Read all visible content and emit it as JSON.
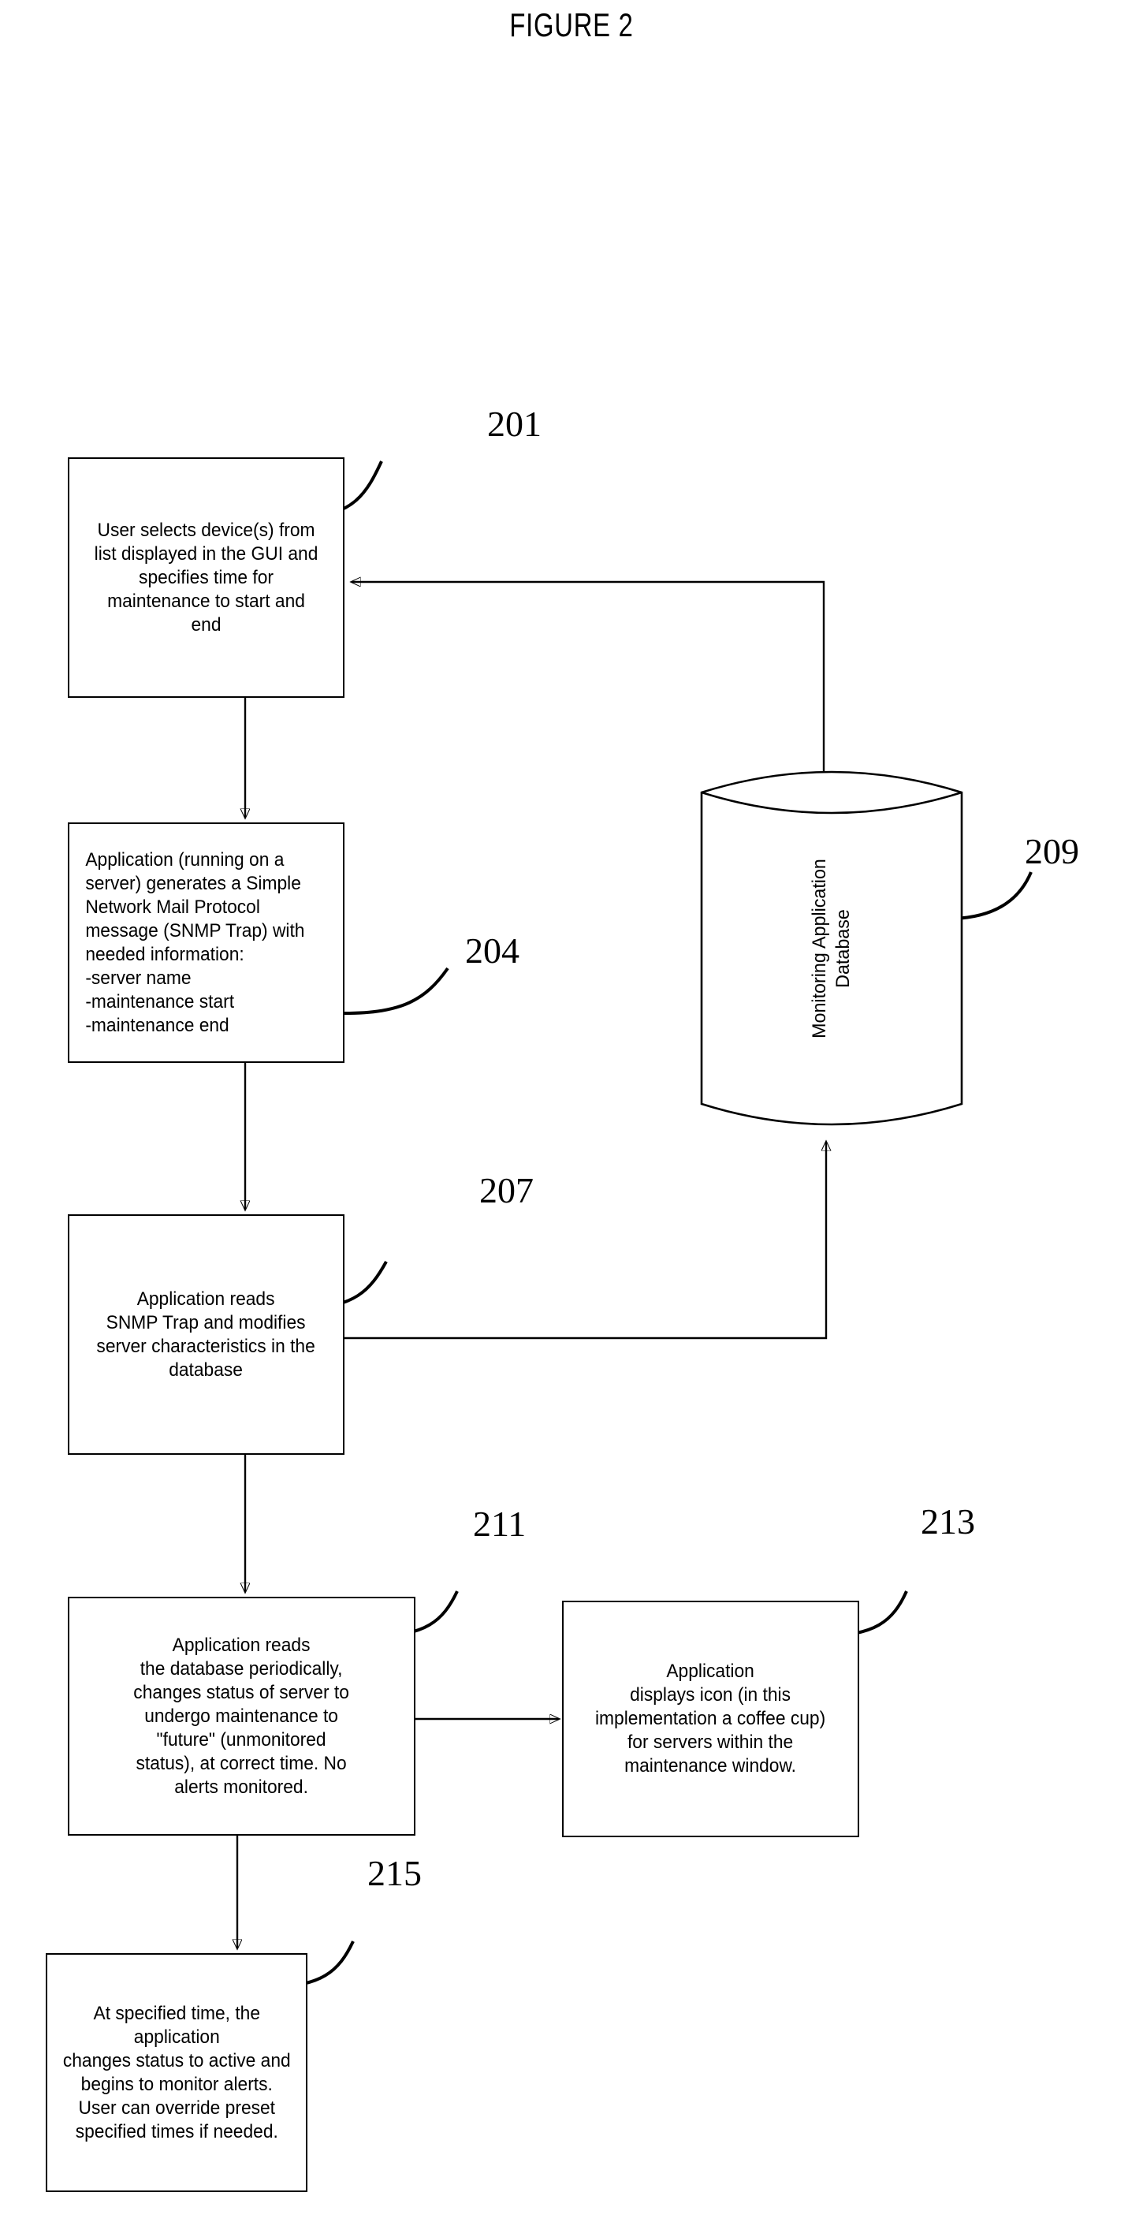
{
  "figure": {
    "title": "FIGURE 2",
    "type": "patent-flowchart"
  },
  "nodes": [
    {
      "id": "201",
      "ref": "201",
      "shape": "process-box",
      "align": "center",
      "text": "User selects device(s) from\nlist displayed in the GUI and\nspecifies time for\nmaintenance to start and\nend"
    },
    {
      "id": "204",
      "ref": "204",
      "shape": "process-box",
      "align": "left",
      "text": "Application (running on a\nserver) generates a Simple\nNetwork Mail Protocol\nmessage (SNMP Trap) with\nneeded information:\n-server name\n-maintenance start\n-maintenance end"
    },
    {
      "id": "207",
      "ref": "207",
      "shape": "process-box",
      "align": "center",
      "text": "Application reads\nSNMP Trap and modifies\nserver characteristics in the\ndatabase"
    },
    {
      "id": "209",
      "ref": "209",
      "shape": "cylinder-database",
      "align": "center",
      "text": "Monitoring Application\nDatabase"
    },
    {
      "id": "211",
      "ref": "211",
      "shape": "process-box",
      "align": "center",
      "text": "Application reads\nthe database periodically,\nchanges status of server to\nundergo maintenance to\n\"future\" (unmonitored\nstatus), at correct time. No\nalerts monitored."
    },
    {
      "id": "213",
      "ref": "213",
      "shape": "process-box",
      "align": "center",
      "text": "Application\ndisplays icon  (in this\nimplementation a coffee cup)\nfor servers within the\nmaintenance window."
    },
    {
      "id": "215",
      "ref": "215",
      "shape": "process-box",
      "align": "center",
      "text": "At specified time, the\napplication\nchanges status to active and\nbegins to monitor alerts.\nUser can override preset\nspecified times if needed."
    }
  ],
  "edges": [
    {
      "from": "201",
      "to": "204",
      "style": "arrow-down"
    },
    {
      "from": "204",
      "to": "207",
      "style": "arrow-down"
    },
    {
      "from": "207",
      "to": "211",
      "style": "arrow-down"
    },
    {
      "from": "207",
      "to": "209",
      "style": "arrow-right-up"
    },
    {
      "from": "209",
      "to": "201",
      "style": "arrow-up-left"
    },
    {
      "from": "211",
      "to": "213",
      "style": "arrow-right"
    },
    {
      "from": "211",
      "to": "215",
      "style": "arrow-down"
    }
  ],
  "colors": {
    "stroke": "#000000",
    "background": "#ffffff"
  }
}
